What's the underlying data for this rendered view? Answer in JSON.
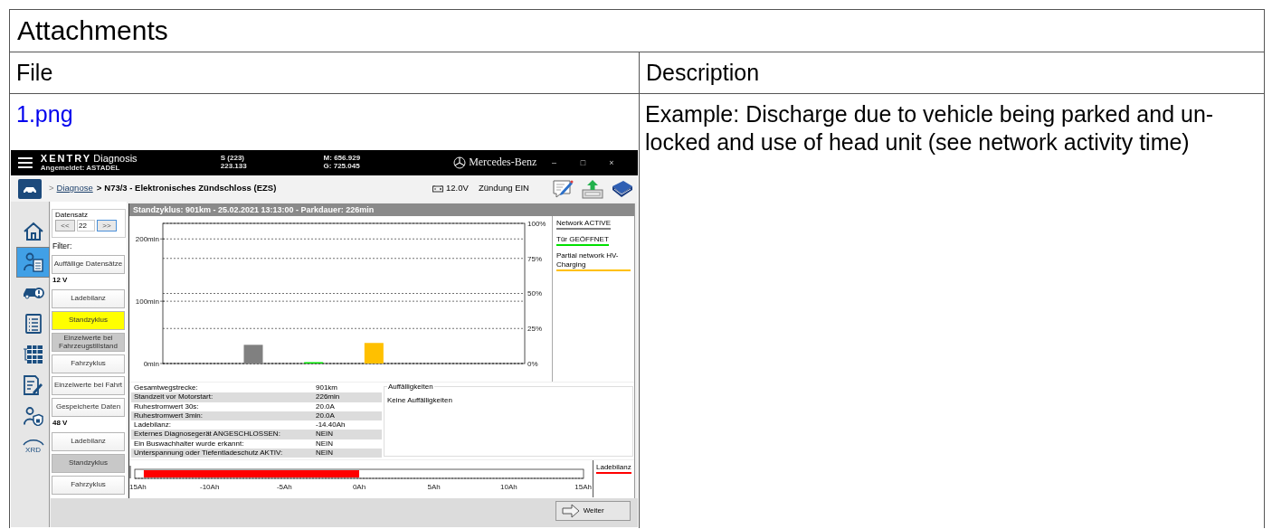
{
  "section_title": "Attachments",
  "columns": [
    "File",
    "Description"
  ],
  "rows": [
    {
      "file": {
        "name": "1.png",
        "screenshot": {
          "title": {
            "brand": "XENTRY",
            "product": "Diagnosis",
            "user": "Angemeldet: ASTADEL"
          },
          "readouts": [
            {
              "line_1": "S (223)",
              "line_2": "223.133"
            },
            {
              "line_1": "M: 656.929",
              "line_2": "G: 725.045"
            }
          ],
          "brand_name": "Mercedes-Benz",
          "window_controls": [
            "–",
            "□",
            "×"
          ],
          "breadcrumb": [
            {
              "separator": ">",
              "label": "Diagnose",
              "kind": "link"
            },
            {
              "separator": ">",
              "label": "N73/3 - Elektronisches Zündschloss (EZS)",
              "kind": "current"
            }
          ],
          "voltage": "12.0V",
          "ignition": "Zündung EIN",
          "rail": [
            {
              "kind": "home",
              "selected": false
            },
            {
              "kind": "diagnosis",
              "selected": true
            },
            {
              "kind": "vehicle",
              "selected": false
            },
            {
              "kind": "list",
              "selected": false
            },
            {
              "kind": "grid",
              "selected": false
            },
            {
              "kind": "notes",
              "selected": false
            },
            {
              "kind": "security",
              "selected": false
            },
            {
              "kind": "xrd",
              "label": "XRD",
              "selected": false
            }
          ],
          "record": {
            "label": "Datensatz",
            "prev": "<<",
            "value": "22",
            "next": ">>"
          },
          "filters": [
            {
              "kind": "heading",
              "label": "Filter:"
            },
            {
              "kind": "button",
              "label": "Auffällige Datensätze",
              "selected": false,
              "disabled": false
            },
            {
              "kind": "heading",
              "label": "12 V"
            },
            {
              "kind": "button",
              "label": "Ladebilanz",
              "selected": false,
              "disabled": false
            },
            {
              "kind": "button",
              "label": "Standzyklus",
              "selected": true,
              "disabled": false
            },
            {
              "kind": "button",
              "label": "Einzelwerte bei Fahrzeugstillstand",
              "selected": false,
              "disabled": true
            },
            {
              "kind": "button",
              "label": "Fahrzyklus",
              "selected": false,
              "disabled": false
            },
            {
              "kind": "button",
              "label": "Einzelwerte bei Fahrt",
              "selected": false,
              "disabled": false
            },
            {
              "kind": "button",
              "label": "Gespeicherte Daten",
              "selected": false,
              "disabled": false
            },
            {
              "kind": "heading",
              "label": "48 V"
            },
            {
              "kind": "button",
              "label": "Ladebilanz",
              "selected": false,
              "disabled": false
            },
            {
              "kind": "button",
              "label": "Standzyklus",
              "selected": false,
              "disabled": true
            },
            {
              "kind": "button",
              "label": "Fahrzyklus",
              "selected": false,
              "disabled": false
            }
          ],
          "panel_title": "Standzyklus: 901km - 25.02.2021 13:13:00 - Parkdauer: 226min",
          "activity_chart": {
            "chart_data": {
              "type": "bar",
              "ylim": [
                0,
                225
              ],
              "y2lim": [
                0,
                1
              ],
              "grid": true,
              "yticks": [
                {
                  "value": 0,
                  "label": "0min"
                },
                {
                  "value": 100,
                  "label": "100min"
                },
                {
                  "value": 200,
                  "label": "200min"
                }
              ],
              "y2ticks": [
                {
                  "value": 0,
                  "label": "0%"
                },
                {
                  "value": 0.25,
                  "label": "25%"
                },
                {
                  "value": 0.5,
                  "label": "50%"
                },
                {
                  "value": 0.75,
                  "label": "75%"
                },
                {
                  "value": 1,
                  "label": "100%"
                }
              ],
              "series": [
                {
                  "name": "Network ACTIVE",
                  "color": "#808080",
                  "values": [
                    null,
                    30,
                    null,
                    null,
                    null,
                    null
                  ]
                },
                {
                  "name": "Tür GEÖFFNET",
                  "color": "#00e000",
                  "values": [
                    null,
                    null,
                    2,
                    null,
                    null,
                    null
                  ]
                },
                {
                  "name": "Partial network HV-Charging",
                  "color": "#ffc000",
                  "values": [
                    null,
                    null,
                    null,
                    33,
                    null,
                    null
                  ]
                }
              ]
            }
          },
          "values": [
            {
              "label": "Gesamtwegstrecke:",
              "value": "901km"
            },
            {
              "label": "Standzeit vor Motorstart:",
              "value": "226min"
            },
            {
              "label": "Ruhestromwert 30s:",
              "value": "20.0A"
            },
            {
              "label": "Ruhestromwert 3min:",
              "value": "20.0A"
            },
            {
              "label": "Ladebilanz:",
              "value": "-14.40Ah"
            },
            {
              "label": "Externes Diagnosegerät ANGESCHLOSSEN:",
              "value": "NEIN"
            },
            {
              "label": "Ein Buswachhalter wurde erkannt:",
              "value": "NEIN"
            },
            {
              "label": "Unterspannung oder Tiefentladeschutz AKTIV:",
              "value": "NEIN"
            }
          ],
          "findings": {
            "title": "Auffälligkeiten",
            "text": "Keine Auffälligkeiten"
          },
          "balance_chart": {
            "chart_data": {
              "type": "bar",
              "orientation": "horizontal",
              "xlim": [
                -15,
                15
              ],
              "xticks": [
                {
                  "value": -15,
                  "label": "15Ah"
                },
                {
                  "value": -10,
                  "label": "-10Ah"
                },
                {
                  "value": -5,
                  "label": "-5Ah"
                },
                {
                  "value": 0,
                  "label": "0Ah"
                },
                {
                  "value": 5,
                  "label": "5Ah"
                },
                {
                  "value": 10,
                  "label": "10Ah"
                },
                {
                  "value": 15,
                  "label": "15Ah"
                }
              ],
              "series": [
                {
                  "name": "Ladebilanz",
                  "color": "#ff0000",
                  "values": [
                    -14.4
                  ]
                }
              ]
            }
          },
          "next_button": "Weiter"
        }
      },
      "description": "Example: Discharge due to vehicle being parked and un-locked and use of head unit (see network activity time)"
    }
  ]
}
